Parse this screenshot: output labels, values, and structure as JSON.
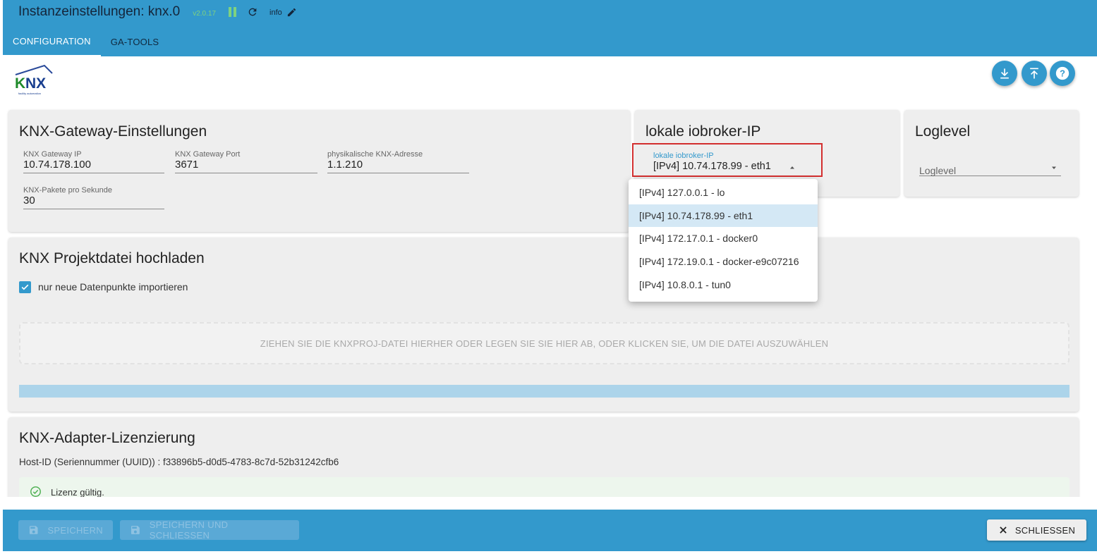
{
  "header": {
    "title": "Instanzeinstellungen: knx.0",
    "version": "v2.0.17",
    "info_label": "info",
    "accent_color": "#3399cc",
    "status_color": "#7fd27f",
    "icons": [
      "pause-icon",
      "reload-icon",
      "edit-icon"
    ]
  },
  "tabs": [
    {
      "label": "CONFIGURATION",
      "active": true
    },
    {
      "label": "GA-TOOLS",
      "active": false
    }
  ],
  "logo": {
    "text": "KNX",
    "tagline": "facility automation"
  },
  "action_buttons": [
    "download-icon",
    "upload-icon",
    "help-icon"
  ],
  "gateway": {
    "title": "KNX-Gateway-Einstellungen",
    "fields": [
      {
        "label": "KNX Gateway IP",
        "value": "10.74.178.100"
      },
      {
        "label": "KNX Gateway Port",
        "value": "3671"
      },
      {
        "label": "physikalische KNX-Adresse",
        "value": "1.1.210"
      },
      {
        "label": "KNX-Pakete pro Sekunde",
        "value": "30"
      }
    ]
  },
  "local_ip": {
    "title": "lokale iobroker-IP",
    "label": "lokale iobroker-IP",
    "value": "[IPv4] 10.74.178.99 - eth1",
    "options": [
      "[IPv4] 127.0.0.1 - lo",
      "[IPv4] 10.74.178.99 - eth1",
      "[IPv4] 172.17.0.1 - docker0",
      "[IPv4] 172.19.0.1 - docker-e9c07216",
      "[IPv4] 10.8.0.1 - tun0"
    ],
    "selected_index": 1
  },
  "loglevel": {
    "title": "Loglevel",
    "placeholder": "Loglevel"
  },
  "upload": {
    "title": "KNX Projektdatei hochladen",
    "checkbox_label": "nur neue Datenpunkte importieren",
    "checkbox_checked": true,
    "dropzone_text": "ZIEHEN SIE DIE KNXPROJ-DATEI HIERHER ODER LEGEN SIE SIE HIER AB, ODER KLICKEN SIE, UM DIE DATEI AUSZUWÄHLEN"
  },
  "license": {
    "title": "KNX-Adapter-Lizenzierung",
    "host_id": "Host-ID (Seriennummer (UUID)) : f33896b5-d0d5-4783-8c7d-52b31242cfb6",
    "status": "Lizenz gültig."
  },
  "footer": {
    "save": "SPEICHERN",
    "save_close": "SPEICHERN UND SCHLIESSEN",
    "close": "SCHLIESSEN"
  }
}
